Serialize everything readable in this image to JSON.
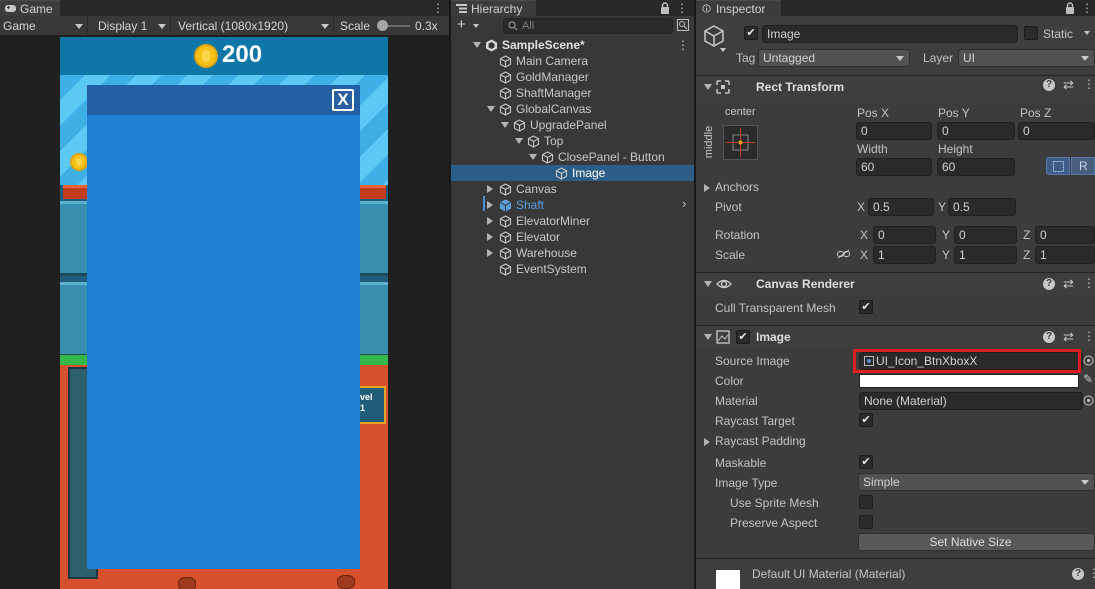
{
  "game": {
    "tab_label": "Game",
    "toolbar": {
      "mode": "Game",
      "display": "Display 1",
      "resolution": "Vertical (1080x1920)",
      "scale_label": "Scale",
      "scale_value": "0.3x"
    },
    "view": {
      "score": "200",
      "level_text": "vel",
      "level_num": "1",
      "close_glyph": "X"
    }
  },
  "hierarchy": {
    "tab_label": "Hierarchy",
    "search_placeholder": "All",
    "add_label": "+",
    "rows": [
      {
        "label": "SampleScene*",
        "depth": 0,
        "arrow": "open",
        "icon": "unity-scene-icon",
        "bold": true
      },
      {
        "label": "Main Camera",
        "depth": 1,
        "arrow": "none",
        "icon": "gameobject-icon"
      },
      {
        "label": "GoldManager",
        "depth": 1,
        "arrow": "none",
        "icon": "gameobject-icon"
      },
      {
        "label": "ShaftManager",
        "depth": 1,
        "arrow": "none",
        "icon": "gameobject-icon"
      },
      {
        "label": "GlobalCanvas",
        "depth": 1,
        "arrow": "open",
        "icon": "gameobject-icon"
      },
      {
        "label": "UpgradePanel",
        "depth": 2,
        "arrow": "open",
        "icon": "gameobject-icon"
      },
      {
        "label": "Top",
        "depth": 3,
        "arrow": "open",
        "icon": "gameobject-icon"
      },
      {
        "label": "ClosePanel - Button",
        "depth": 4,
        "arrow": "open",
        "icon": "gameobject-icon"
      },
      {
        "label": "Image",
        "depth": 5,
        "arrow": "none",
        "icon": "gameobject-icon",
        "selected": true
      },
      {
        "label": "Canvas",
        "depth": 1,
        "arrow": "closed",
        "icon": "gameobject-icon"
      },
      {
        "label": "Shaft",
        "depth": 1,
        "arrow": "closed",
        "icon": "prefab-icon",
        "prefab": true
      },
      {
        "label": "ElevatorMiner",
        "depth": 1,
        "arrow": "closed",
        "icon": "gameobject-icon"
      },
      {
        "label": "Elevator",
        "depth": 1,
        "arrow": "closed",
        "icon": "gameobject-icon"
      },
      {
        "label": "Warehouse",
        "depth": 1,
        "arrow": "closed",
        "icon": "gameobject-icon"
      },
      {
        "label": "EventSystem",
        "depth": 1,
        "arrow": "none",
        "icon": "gameobject-icon"
      }
    ]
  },
  "inspector": {
    "tab_label": "Inspector",
    "object_name": "Image",
    "static_label": "Static",
    "tag_label": "Tag",
    "tag_value": "Untagged",
    "layer_label": "Layer",
    "layer_value": "UI",
    "rect_transform": {
      "title": "Rect Transform",
      "anchor_h": "center",
      "anchor_v": "middle",
      "pos_x_label": "Pos X",
      "pos_x": "0",
      "pos_y_label": "Pos Y",
      "pos_y": "0",
      "pos_z_label": "Pos Z",
      "pos_z": "0",
      "width_label": "Width",
      "width": "60",
      "height_label": "Height",
      "height": "60",
      "r_label": "R",
      "anchors_label": "Anchors",
      "pivot_label": "Pivot",
      "pivot_x": "0.5",
      "pivot_y": "0.5",
      "rotation_label": "Rotation",
      "rot_x": "0",
      "rot_y": "0",
      "rot_z": "0",
      "scale_label": "Scale",
      "scale_x": "1",
      "scale_y": "1",
      "scale_z": "1",
      "x": "X",
      "y": "Y",
      "z": "Z"
    },
    "canvas_renderer": {
      "title": "Canvas Renderer",
      "cull_label": "Cull Transparent Mesh",
      "cull_checked": true
    },
    "image": {
      "title": "Image",
      "source_label": "Source Image",
      "source_value": "UI_Icon_BtnXboxX",
      "color_label": "Color",
      "material_label": "Material",
      "material_value": "None (Material)",
      "raycast_target_label": "Raycast Target",
      "raycast_padding_label": "Raycast Padding",
      "maskable_label": "Maskable",
      "image_type_label": "Image Type",
      "image_type_value": "Simple",
      "use_sprite_mesh_label": "Use Sprite Mesh",
      "preserve_aspect_label": "Preserve Aspect",
      "native_size_label": "Set Native Size"
    },
    "material_footer": "Default UI Material (Material)",
    "colors": {
      "highlight": "#e01c24",
      "selection": "#2c5d87",
      "prefab": "#5a9fe0"
    }
  }
}
